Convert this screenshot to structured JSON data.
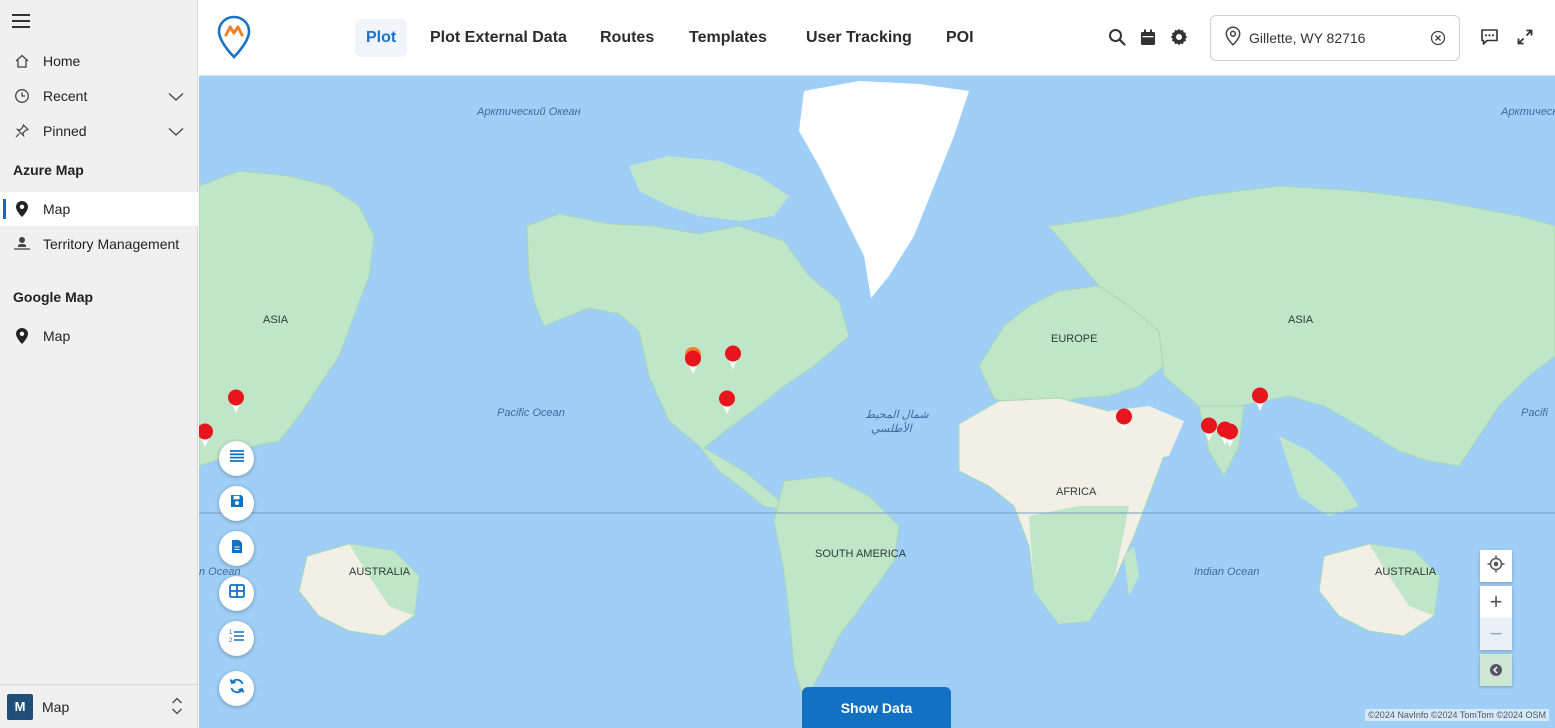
{
  "sidebar": {
    "items": [
      {
        "label": "Home"
      },
      {
        "label": "Recent"
      },
      {
        "label": "Pinned"
      }
    ],
    "groups": [
      {
        "title": "Azure Map",
        "items": [
          {
            "label": "Map"
          },
          {
            "label": "Territory Management"
          }
        ]
      },
      {
        "title": "Google Map",
        "items": [
          {
            "label": "Map"
          }
        ]
      }
    ],
    "footer": {
      "badge": "M",
      "area": "Map"
    }
  },
  "topbar": {
    "tabs": [
      {
        "label": "Plot"
      },
      {
        "label": "Plot External Data"
      },
      {
        "label": "Routes"
      },
      {
        "label": "Templates"
      },
      {
        "label": "User Tracking"
      },
      {
        "label": "POI"
      }
    ],
    "location_value": "Gillette, WY 82716"
  },
  "map": {
    "labels": {
      "arctic_ru": "Арктический Океан",
      "arctic_ru_right": "Арктический",
      "pacific": "Pacific Ocean",
      "pacific_right": "Pacifi",
      "atlantic_ar_1": "شمال المحيط",
      "atlantic_ar_2": "الأطلسي",
      "indian": "Indian Ocean",
      "ocean_left": "n Ocean",
      "asia_left": "ASIA",
      "asia_right": "ASIA",
      "europe": "EUROPE",
      "africa": "AFRICA",
      "south_america": "SOUTH AMERICA",
      "australia_left": "AUSTRALIA",
      "australia_right": "AUSTRALIA"
    },
    "show_data_label": "Show Data",
    "attribution": "©2024 NavInfo  ©2024 TomTom  ©2024 OSM",
    "zoom_in": "+",
    "zoom_out": "−"
  },
  "colors": {
    "water": "#9fcff7",
    "land": "#bfe6c8",
    "desert": "#f2efe6",
    "ice": "#ffffff",
    "marker_red": "#e8161c",
    "marker_orange": "#f07f2b",
    "accent": "#1371c4"
  }
}
